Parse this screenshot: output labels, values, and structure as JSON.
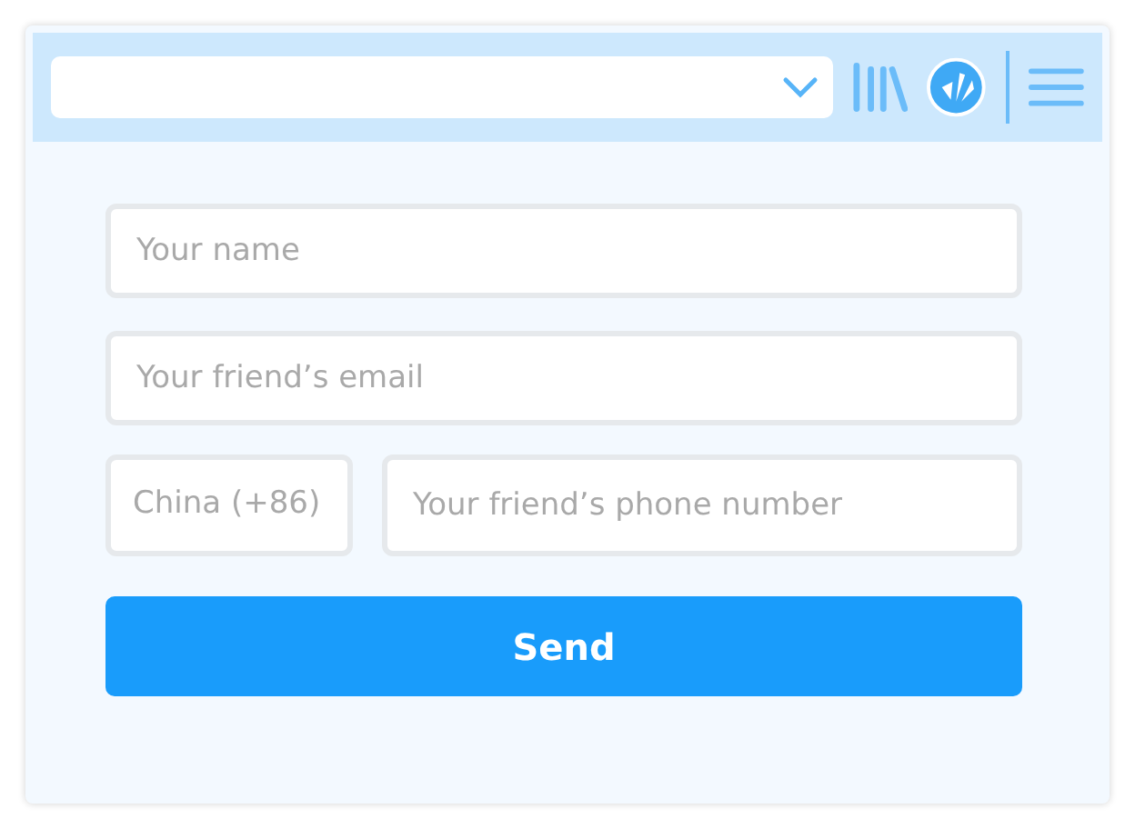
{
  "form": {
    "name": {
      "placeholder": "Your name"
    },
    "email": {
      "placeholder": "Your friend’s email"
    },
    "country": {
      "value": "China (+86)"
    },
    "phone": {
      "placeholder": "Your friend’s phone number"
    },
    "send_button": "Send"
  }
}
